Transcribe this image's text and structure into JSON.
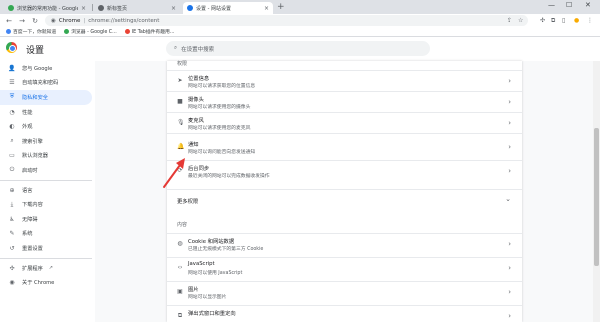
{
  "tabs": [
    {
      "title": "浏览器的常用功能 - Google Ch...",
      "active": false,
      "favicon_color": "#34a853"
    },
    {
      "title": "新标签页",
      "active": false,
      "favicon_color": "#5f6368"
    },
    {
      "title": "设置 - 网站设置",
      "active": true,
      "favicon_color": "#1a73e8"
    }
  ],
  "toolbar": {
    "chrome_label": "Chrome",
    "url": "chrome://settings/content"
  },
  "bookmarks": [
    {
      "label": "百度一下，你就知道",
      "color": "#4285f4"
    },
    {
      "label": "浏览器 - Google C...",
      "color": "#34a853"
    },
    {
      "label": "IE Tab插件有趣用...",
      "color": "#ea4335"
    }
  ],
  "header": {
    "title": "设置",
    "search_placeholder": "在设置中搜索"
  },
  "sidebar": {
    "items": [
      {
        "label": "您与 Google",
        "icon": "person-icon",
        "glyph": "👤",
        "selected": false
      },
      {
        "label": "自动填充和密码",
        "icon": "autofill-icon",
        "glyph": "☰",
        "selected": false
      },
      {
        "label": "隐私和安全",
        "icon": "shield-icon",
        "glyph": "⛨",
        "selected": true
      },
      {
        "label": "性能",
        "icon": "speedometer-icon",
        "glyph": "◔",
        "selected": false
      },
      {
        "label": "外观",
        "icon": "palette-icon",
        "glyph": "◐",
        "selected": false
      },
      {
        "label": "搜索引擎",
        "icon": "search-icon",
        "glyph": "⌕",
        "selected": false
      },
      {
        "label": "默认浏览器",
        "icon": "browser-icon",
        "glyph": "▭",
        "selected": false
      },
      {
        "label": "启动时",
        "icon": "power-icon",
        "glyph": "⏻",
        "selected": false
      },
      {
        "label": "语言",
        "icon": "globe-icon",
        "glyph": "⊕",
        "selected": false
      },
      {
        "label": "下载内容",
        "icon": "download-icon",
        "glyph": "⤓",
        "selected": false
      },
      {
        "label": "无障碍",
        "icon": "accessibility-icon",
        "glyph": "♿",
        "selected": false
      },
      {
        "label": "系统",
        "icon": "wrench-icon",
        "glyph": "✎",
        "selected": false
      },
      {
        "label": "重置设置",
        "icon": "reset-icon",
        "glyph": "↺",
        "selected": false
      },
      {
        "label": "扩展程序",
        "icon": "puzzle-icon",
        "glyph": "✣",
        "selected": false
      },
      {
        "label": "关于 Chrome",
        "icon": "chrome-icon",
        "glyph": "◉",
        "selected": false
      }
    ]
  },
  "main": {
    "permissions_heading": "权限",
    "permissions": [
      {
        "title": "位置信息",
        "subtitle": "网站可以请求获取您的位置信息",
        "icon": "location-icon",
        "glyph": "➤"
      },
      {
        "title": "摄像头",
        "subtitle": "网站可以请求使用您的摄像头",
        "icon": "camera-icon",
        "glyph": "■"
      },
      {
        "title": "麦克风",
        "subtitle": "网站可以请求使用您的麦克风",
        "icon": "microphone-icon",
        "glyph": "🎙"
      },
      {
        "title": "通知",
        "subtitle": "网站可以询问能否向您发送通知",
        "icon": "bell-icon",
        "glyph": "🔔"
      },
      {
        "title": "后台同步",
        "subtitle": "最近关闭的网站可以完成数据收发操作",
        "icon": "sync-icon",
        "glyph": "⟳"
      }
    ],
    "more_permissions_label": "更多权限",
    "content_heading": "内容",
    "content": [
      {
        "title": "Cookie 和网站数据",
        "subtitle": "已阻止无痕模式下的第三方 Cookie",
        "icon": "cookie-icon",
        "glyph": "◍"
      },
      {
        "title": "JavaScript",
        "subtitle": "网站可以使用 JavaScript",
        "icon": "code-icon",
        "glyph": "‹›"
      },
      {
        "title": "图片",
        "subtitle": "网站可以显示图片",
        "icon": "image-icon",
        "glyph": "▣"
      },
      {
        "title": "弹出式窗口和重定向",
        "subtitle": "",
        "icon": "popup-icon",
        "glyph": "⧉"
      }
    ]
  },
  "colors": {
    "accent": "#1a73e8",
    "annotation_arrow": "#e53935"
  }
}
